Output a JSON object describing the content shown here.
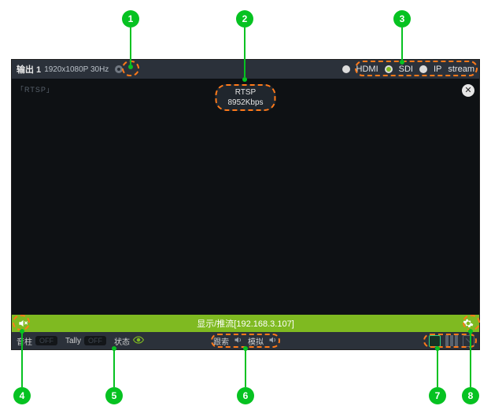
{
  "header": {
    "title": "输出 1",
    "resolution": "1920x1080P 30Hz",
    "outputs": [
      {
        "name": "HDMI",
        "on": false
      },
      {
        "name": "SDI",
        "on": true
      },
      {
        "name": "IP",
        "on": false
      },
      {
        "name": "stream",
        "on": false
      }
    ]
  },
  "video": {
    "corner_tag": "「RTSP」",
    "pill": {
      "line1": "RTSP",
      "line2": "8952Kbps"
    }
  },
  "status": {
    "text": "显示/推流[192.168.3.107]"
  },
  "footer": {
    "left": [
      {
        "label": "音柱",
        "chip": "OFF"
      },
      {
        "label": "Tally",
        "chip": "OFF"
      },
      {
        "label": "状态",
        "icon": "eye"
      }
    ],
    "center": [
      {
        "label": "跟索",
        "icon": "speaker"
      },
      {
        "label": "模拟",
        "icon": "speaker"
      }
    ]
  },
  "callouts": {
    "1": "1",
    "2": "2",
    "3": "3",
    "4": "4",
    "5": "5",
    "6": "6",
    "7": "7",
    "8": "8"
  }
}
